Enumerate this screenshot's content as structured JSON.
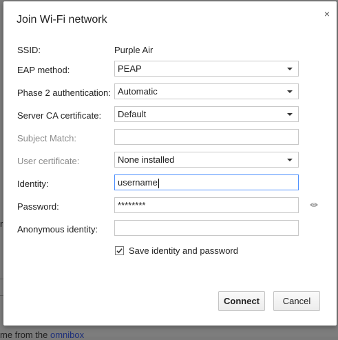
{
  "dialog": {
    "title": "Join Wi-Fi network",
    "close_glyph": "×"
  },
  "form": {
    "ssid": {
      "label": "SSID:",
      "value": "Purple Air"
    },
    "eap_method": {
      "label": "EAP method:",
      "value": "PEAP"
    },
    "phase2": {
      "label": "Phase 2 authentication:",
      "value": "Automatic"
    },
    "server_ca": {
      "label": "Server CA certificate:",
      "value": "Default"
    },
    "subject_match": {
      "label": "Subject Match:",
      "value": ""
    },
    "user_cert": {
      "label": "User certificate:",
      "value": "None installed"
    },
    "identity": {
      "label": "Identity:",
      "value": "username"
    },
    "password": {
      "label": "Password:",
      "value": "********"
    },
    "anon_identity": {
      "label": "Anonymous identity:",
      "value": ""
    },
    "save_checkbox": {
      "label": "Save identity and password",
      "checked": true
    }
  },
  "buttons": {
    "connect": "Connect",
    "cancel": "Cancel"
  },
  "background": {
    "snippet_char": "r",
    "footer_text": "me from the ",
    "footer_link": "omnibox"
  },
  "icons": {
    "eye": "eye-icon",
    "close": "close-icon",
    "checkmark": "checkmark-icon",
    "dropdown": "chevron-down-icon"
  },
  "colors": {
    "focus_border": "#4d90fe",
    "disabled_label": "#8a8a8a",
    "link": "#1d2f7a"
  }
}
